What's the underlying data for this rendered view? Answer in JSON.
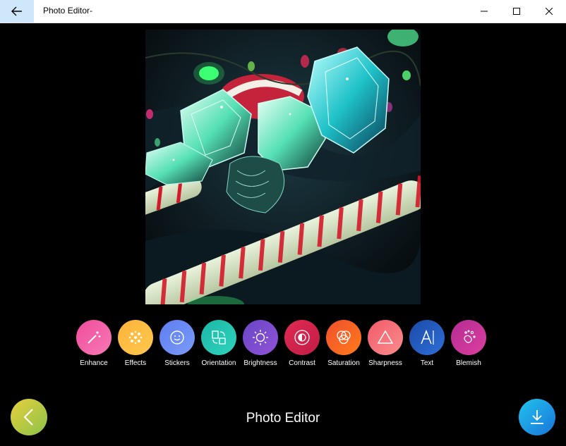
{
  "window": {
    "title": "Photo Editor-"
  },
  "icons": {
    "back": "arrow-left-icon",
    "minimize": "minimize-icon",
    "maximize": "maximize-icon",
    "close": "close-icon",
    "nav_back": "chevron-left-icon",
    "download": "download-icon"
  },
  "photo": {
    "subject": "crystal gems and candy canes with lights"
  },
  "tools": [
    {
      "label": "Enhance",
      "icon": "magic-wand-icon",
      "c1": "#f04c9b",
      "c2": "#f77ab6"
    },
    {
      "label": "Effects",
      "icon": "dots-icon",
      "c1": "#ffb33a",
      "c2": "#ffc84d"
    },
    {
      "label": "Stickers",
      "icon": "smiley-icon",
      "c1": "#5d7df1",
      "c2": "#7c9bf7"
    },
    {
      "label": "Orientation",
      "icon": "rotate-icon",
      "c1": "#1bb8a7",
      "c2": "#2fd3bd"
    },
    {
      "label": "Brightness",
      "icon": "sun-icon",
      "c1": "#6a46c7",
      "c2": "#9053d6"
    },
    {
      "label": "Contrast",
      "icon": "contrast-icon",
      "c1": "#e02a52",
      "c2": "#c11d47"
    },
    {
      "label": "Saturation",
      "icon": "circles-icon",
      "c1": "#f14f2c",
      "c2": "#ff7b1c"
    },
    {
      "label": "Sharpness",
      "icon": "triangle-icon",
      "c1": "#f35a6a",
      "c2": "#f98d8c"
    },
    {
      "label": "Text",
      "icon": "text-icon",
      "c1": "#1b4aa8",
      "c2": "#2f6fd6"
    },
    {
      "label": "Blemish",
      "icon": "blemish-icon",
      "c1": "#b52c92",
      "c2": "#db3fa0"
    }
  ],
  "footer": {
    "title": "Photo Editor"
  }
}
